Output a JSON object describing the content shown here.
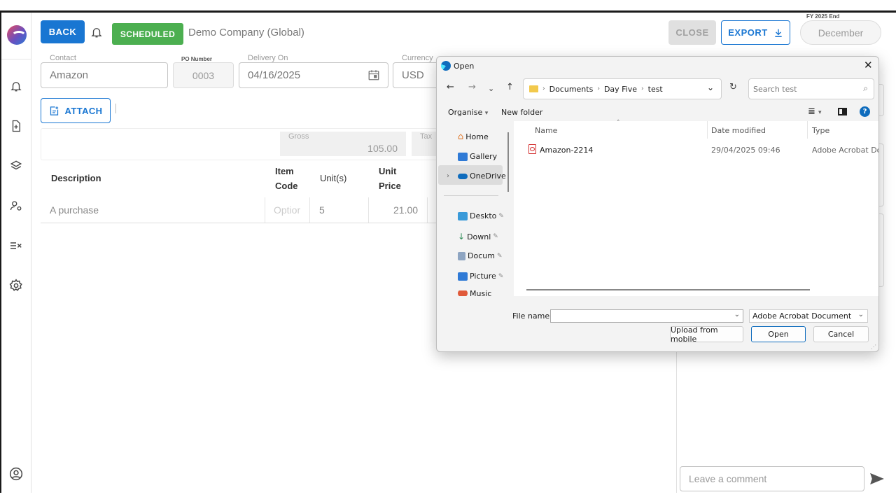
{
  "header": {
    "back_label": "BACK",
    "status_label": "SCHEDULED",
    "company": "Demo Company (Global)",
    "close_label": "CLOSE",
    "export_label": "EXPORT",
    "fy_label": "FY 2025 End",
    "fy_value": "December"
  },
  "form": {
    "contact_label": "Contact",
    "contact_value": "Amazon",
    "po_label": "PO Number",
    "po_value": "0003",
    "delivery_label": "Delivery On",
    "delivery_value": "04/16/2025",
    "currency_label": "Currency",
    "currency_value": "USD",
    "attach_label": "ATTACH"
  },
  "totals": {
    "gross_label": "Gross",
    "gross_value": "105.00",
    "tax_label": "Tax"
  },
  "table": {
    "headers": {
      "description": "Description",
      "item_code_1": "Item",
      "item_code_2": "Code",
      "units": "Unit(s)",
      "unit_price_1": "Unit",
      "unit_price_2": "Price"
    },
    "rows": [
      {
        "description": "A purchase",
        "item_code": "Optior",
        "units": "5",
        "unit_price": "21.00"
      }
    ]
  },
  "comment": {
    "placeholder": "Leave a comment"
  },
  "dialog": {
    "title": "Open",
    "breadcrumb": [
      "Documents",
      "Day Five",
      "test"
    ],
    "search_placeholder": "Search test",
    "organise_label": "Organise",
    "new_folder_label": "New folder",
    "nav_items": [
      "Home",
      "Gallery",
      "OneDrive",
      "Deskto",
      "Downl",
      "Docum",
      "Picture",
      "Music"
    ],
    "columns": {
      "name": "Name",
      "date": "Date modified",
      "type": "Type"
    },
    "files": [
      {
        "name": "Amazon-2214",
        "date": "29/04/2025 09:46",
        "type": "Adobe Acrobat Docu"
      }
    ],
    "file_name_label": "File name:",
    "file_name_value": "",
    "file_type": "Adobe Acrobat Document",
    "upload_label": "Upload from mobile",
    "open_label": "Open",
    "cancel_label": "Cancel"
  }
}
